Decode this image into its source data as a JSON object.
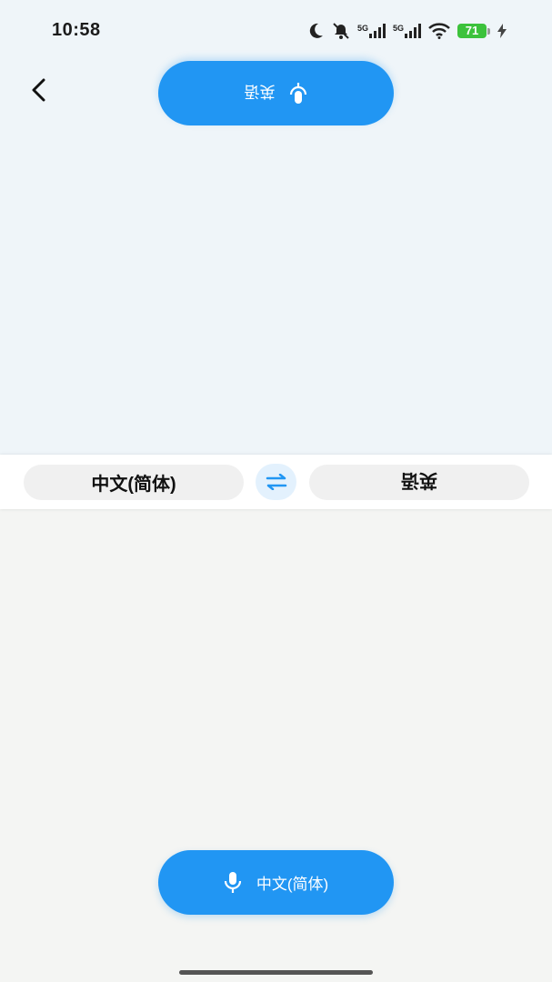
{
  "status_bar": {
    "time": "10:58",
    "network_1": "5G",
    "network_2": "5G",
    "battery_level": "71"
  },
  "top": {
    "target_language_button": "英语"
  },
  "language_bar": {
    "source_language": "中文(简体)",
    "target_language": "英语"
  },
  "bottom": {
    "source_language_button": "中文(简体)"
  },
  "colors": {
    "accent": "#2196f3",
    "top_background": "#eff5f9",
    "bottom_background": "#f4f5f3",
    "battery": "#3cc23c"
  }
}
